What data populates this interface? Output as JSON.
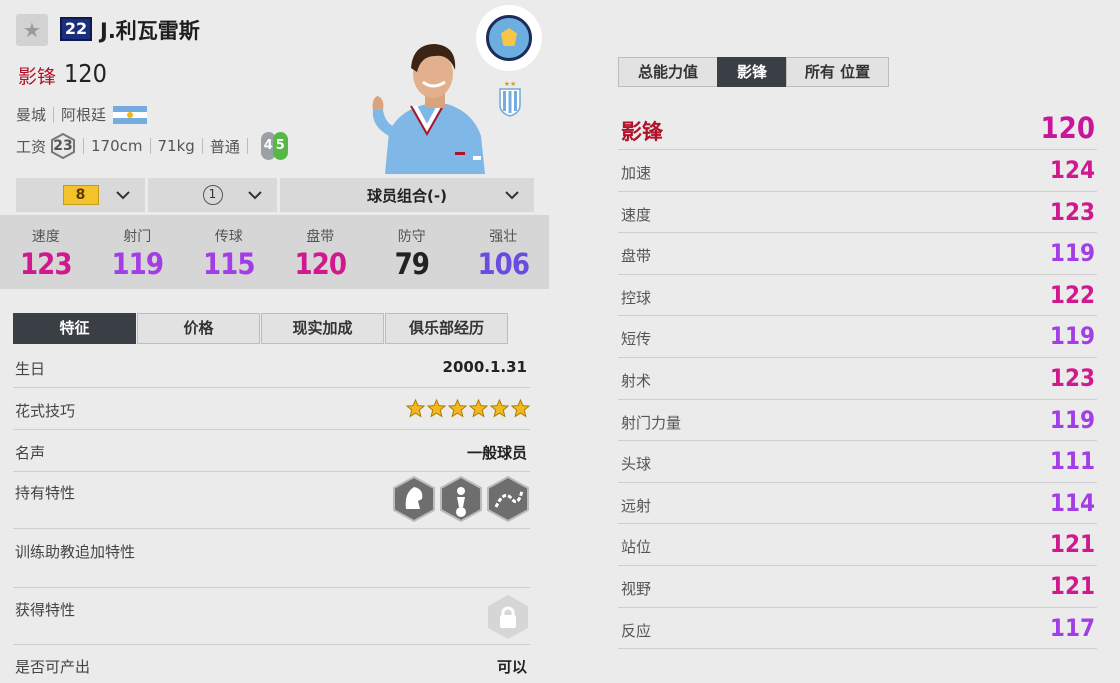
{
  "header": {
    "star_glyph": "★",
    "jersey_number": "22",
    "player_name": "J.利瓦雷斯",
    "position": "影锋",
    "position_ovr": "120"
  },
  "info": {
    "club": "曼城",
    "nation": "阿根廷",
    "wage_label": "工资",
    "wage": "23",
    "height": "170cm",
    "weight": "71kg",
    "body_type": "普通",
    "weak_foot": "4",
    "skill_moves": "5"
  },
  "selectors": {
    "enhance_level": "8",
    "grade": "1",
    "combo_label": "球员组合(-)"
  },
  "main_stats": [
    {
      "label": "速度",
      "value": "123",
      "color": "#d0188f"
    },
    {
      "label": "射门",
      "value": "119",
      "color": "#a33ee6"
    },
    {
      "label": "传球",
      "value": "115",
      "color": "#a33ee6"
    },
    {
      "label": "盘带",
      "value": "120",
      "color": "#d0188f"
    },
    {
      "label": "防守",
      "value": "79",
      "color": "#222222"
    },
    {
      "label": "强壮",
      "value": "106",
      "color": "#6a4de0"
    }
  ],
  "left_tabs": [
    "特征",
    "价格",
    "现实加成",
    "俱乐部经历"
  ],
  "details": {
    "birthday_label": "生日",
    "birthday": "2000.1.31",
    "skill_label": "花式技巧",
    "skill_stars": 6,
    "reputation_label": "名声",
    "reputation": "一般球员",
    "traits_label": "持有特性",
    "coach_traits_label": "训练助教追加特性",
    "acquired_traits_label": "获得特性",
    "producible_label": "是否可产出",
    "producible": "可以"
  },
  "right_tabs": [
    "总能力值",
    "影锋",
    "所有 位置"
  ],
  "position_rating": {
    "label": "影锋",
    "value": "120"
  },
  "attributes": [
    {
      "label": "加速",
      "value": "124",
      "color": "#d0188f"
    },
    {
      "label": "速度",
      "value": "123",
      "color": "#d0188f"
    },
    {
      "label": "盘带",
      "value": "119",
      "color": "#a33ee6"
    },
    {
      "label": "控球",
      "value": "122",
      "color": "#d0188f"
    },
    {
      "label": "短传",
      "value": "119",
      "color": "#a33ee6"
    },
    {
      "label": "射术",
      "value": "123",
      "color": "#d0188f"
    },
    {
      "label": "射门力量",
      "value": "119",
      "color": "#a33ee6"
    },
    {
      "label": "头球",
      "value": "111",
      "color": "#a33ee6"
    },
    {
      "label": "远射",
      "value": "114",
      "color": "#a33ee6"
    },
    {
      "label": "站位",
      "value": "121",
      "color": "#d0188f"
    },
    {
      "label": "视野",
      "value": "121",
      "color": "#d0188f"
    },
    {
      "label": "反应",
      "value": "117",
      "color": "#a33ee6"
    }
  ]
}
